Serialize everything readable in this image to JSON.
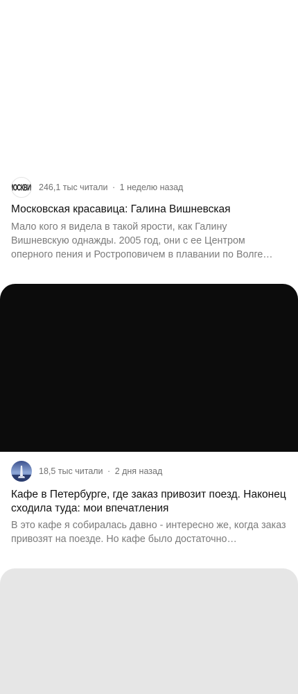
{
  "feed": {
    "cards": [
      {
        "channel_logo": "МОСКВИЧ",
        "views": "246,1 тыс читали",
        "separator": "·",
        "time": "1 неделю назад",
        "title": "Московская красавица: Галина Вишневская",
        "snippet": "Мало кого я видела в такой ярости, как Галину Вишневскую однажды. 2005 год, они с ее Центром оперного пения и Ростроповичем в плавании по Волге…"
      },
      {
        "views": "18,5 тыс читали",
        "separator": "·",
        "time": "2 дня назад",
        "title": "Кафе в Петербурге, где заказ привозит поезд. Наконец сходила туда: мои впечатления",
        "snippet": "В это кафе я собиралась давно - интересно же, когда заказ привозят на поезде. Но кафе было достаточно…"
      }
    ]
  }
}
